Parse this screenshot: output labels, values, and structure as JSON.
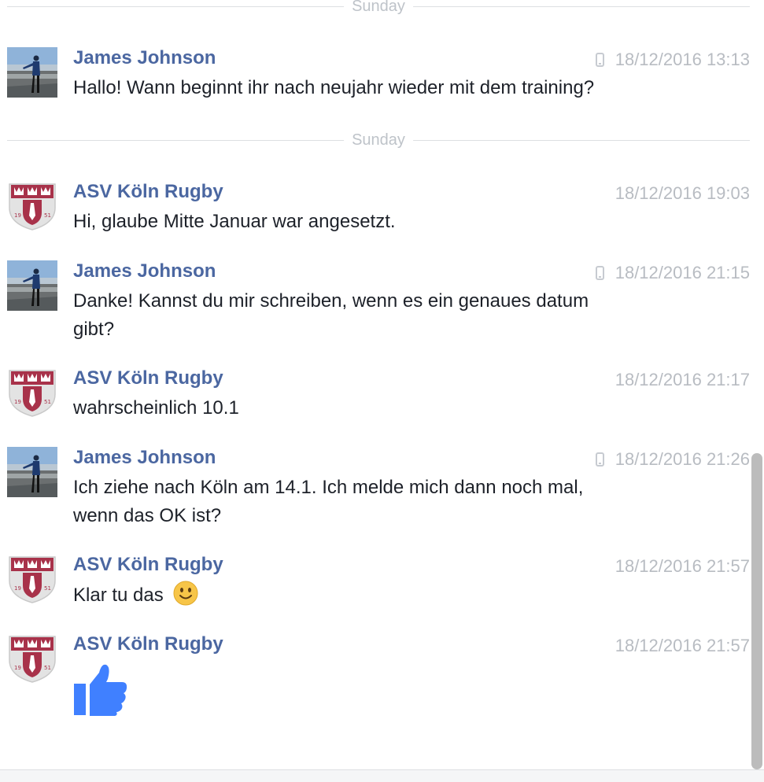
{
  "dividers": [
    "Sunday",
    "Sunday"
  ],
  "messages": [
    {
      "sender": "James Johnson",
      "time": "18/12/2016 13:13",
      "text": "Hallo! Wann beginnt ihr nach neujahr wieder mit dem training?",
      "via_mobile": true
    },
    {
      "sender": "ASV Köln Rugby",
      "time": "18/12/2016 19:03",
      "text": "Hi, glaube Mitte Januar war angesetzt."
    },
    {
      "sender": "James Johnson",
      "time": "18/12/2016 21:15",
      "line1": "Danke! Kannst du mir schreiben, wenn es  ein genaues datum",
      "line2": "gibt?",
      "via_mobile": true
    },
    {
      "sender": "ASV Köln Rugby",
      "time": "18/12/2016 21:17",
      "text": "wahrscheinlich 10.1"
    },
    {
      "sender": "James Johnson",
      "time": "18/12/2016 21:26",
      "line1": "Ich ziehe nach Köln am 14.1. Ich melde mich dann noch mal,",
      "line2": "wenn das OK ist?",
      "via_mobile": true
    },
    {
      "sender": "ASV Köln Rugby",
      "time": "18/12/2016 21:57",
      "text": "Klar tu das",
      "emoji": "slightly-smiling-face"
    },
    {
      "sender": "ASV Köln Rugby",
      "time": "18/12/2016 21:57",
      "sticker": "thumbs-up-like"
    }
  ],
  "colors": {
    "sender": "#4b67a1",
    "timestamp": "#b8bcc2",
    "like": "#4080ff",
    "crest": "#a8324a"
  }
}
